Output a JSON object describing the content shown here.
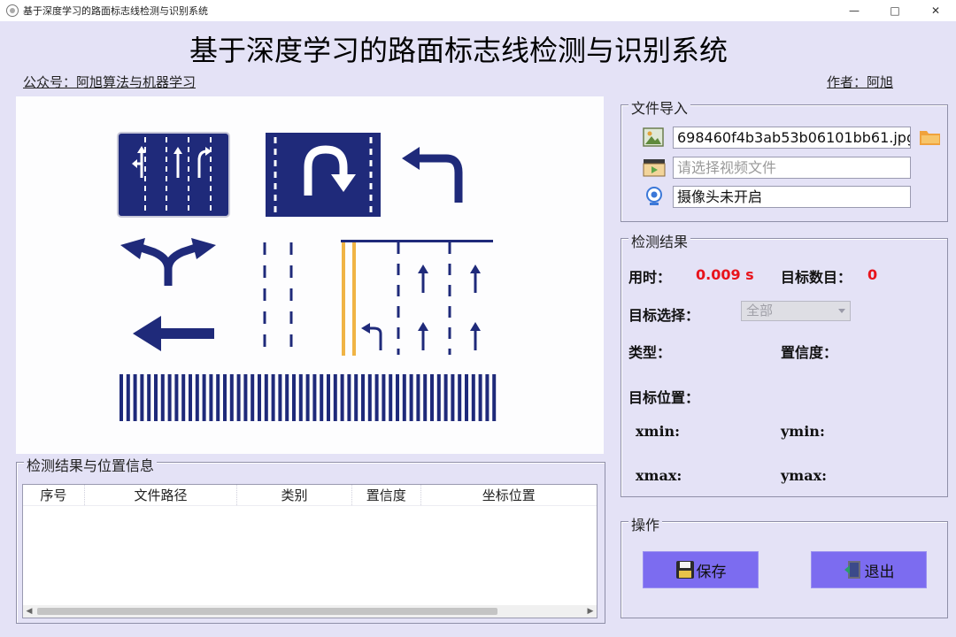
{
  "window": {
    "title": "基于深度学习的路面标志线检测与识别系统",
    "minimize": "—",
    "maximize": "□",
    "close": "✕"
  },
  "header": {
    "title": "基于深度学习的路面标志线检测与识别系统",
    "left_link": "公众号：阿旭算法与机器学习",
    "right_link": "作者：阿旭"
  },
  "image_view": {
    "content": "road-marking-sample-image"
  },
  "results_table": {
    "group_title": "检测结果与位置信息",
    "columns": [
      "序号",
      "文件路径",
      "类别",
      "置信度",
      "坐标位置"
    ],
    "rows": []
  },
  "file_import": {
    "group_title": "文件导入",
    "image_path": "698460f4b3ab53b06101bb61.jpg",
    "video_placeholder": "请选择视频文件",
    "camera_status": "摄像头未开启",
    "icons": [
      "image-file-icon",
      "folder-icon",
      "video-file-icon",
      "camera-icon"
    ]
  },
  "detection": {
    "group_title": "检测结果",
    "time_label": "用时：",
    "time_value": "0.009 s",
    "count_label": "目标数目：",
    "count_value": "0",
    "target_select_label": "目标选择：",
    "target_select_value": "全部",
    "type_label": "类型：",
    "confidence_label": "置信度：",
    "position_label": "目标位置：",
    "xmin_label": "xmin:",
    "ymin_label": "ymin:",
    "xmax_label": "xmax:",
    "ymax_label": "ymax:"
  },
  "operations": {
    "group_title": "操作",
    "save_label": "保存",
    "exit_label": "退出"
  },
  "colors": {
    "background": "#e4e2f6",
    "marking_blue": "#1f2a7a",
    "accent_red": "#e8141c",
    "button_purple": "#7c6cf0",
    "lane_yellow": "#f0b445"
  }
}
